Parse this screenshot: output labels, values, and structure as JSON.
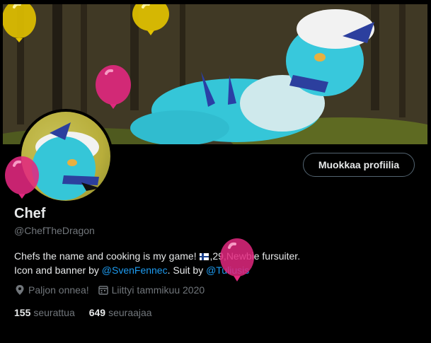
{
  "profile": {
    "display_name": "Chef",
    "handle": "@ChefTheDragon",
    "bio_part1": "Chefs the name and cooking is my game! ",
    "bio_part2": ",29,Newbie fursuiter.",
    "bio_line2_prefix": "Icon and banner by ",
    "bio_link1": "@SvenFennec",
    "bio_line2_mid": ". Suit by ",
    "bio_link2": "@Tuliusis",
    "location": "Paljon onnea!",
    "joined": "Liittyi tammikuu 2020"
  },
  "buttons": {
    "edit_profile": "Muokkaa profiilia"
  },
  "stats": {
    "following_count": "155",
    "following_label": "seurattua",
    "followers_count": "649",
    "followers_label": "seuraajaa"
  },
  "colors": {
    "link": "#1d9bf0",
    "balloon_pink": "#e2287f",
    "balloon_yellow": "#e2c200",
    "muted": "#71767b"
  },
  "icons": [
    "balloon-icon",
    "location-icon",
    "calendar-icon"
  ]
}
